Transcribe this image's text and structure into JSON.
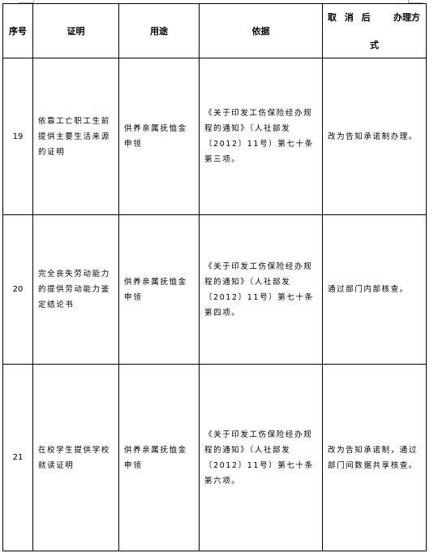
{
  "table": {
    "headers": {
      "seq": "序号",
      "certificate": "证明",
      "purpose": "用途",
      "basis": "依据",
      "after_cancel_a": "取 消 后",
      "after_cancel_b": "办理方",
      "after_cancel_c": "式"
    },
    "rows": [
      {
        "seq": "19",
        "certificate": "依靠工亡职工生前提供主要生活来源的证明",
        "purpose": "供养亲属抚恤金申领",
        "basis": "《关于印发工伤保险经办规程的通知》（人社部发〔2012〕11号）第七十条第三项。",
        "after_cancel": "改为告知承诺制办理。"
      },
      {
        "seq": "20",
        "certificate": "完全丧失劳动能力的提供劳动能力鉴定结论书",
        "purpose": "供养亲属抚恤金申领",
        "basis": "《关于印发工伤保险经办规程的通知》（人社部发〔2012〕11号）第七十条第四项。",
        "after_cancel": "通过部门内部核查。"
      },
      {
        "seq": "21",
        "certificate": "在校学生提供学校就读证明",
        "purpose": "供养亲属抚恤金申领",
        "basis": "《关于印发工伤保险经办规程的通知》（人社部发〔2012〕11号）第七十条第六项。",
        "after_cancel": "改为告知承诺制，通过部门间数据共享核查。"
      }
    ]
  }
}
